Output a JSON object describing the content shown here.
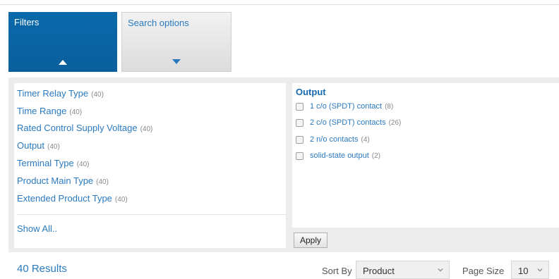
{
  "tabs": {
    "filters_label": "Filters",
    "search_options_label": "Search options"
  },
  "categories": [
    {
      "label": "Timer Relay Type",
      "count": "(40)"
    },
    {
      "label": "Time Range",
      "count": "(40)"
    },
    {
      "label": "Rated Control Supply Voltage",
      "count": "(40)"
    },
    {
      "label": "Output",
      "count": "(40)"
    },
    {
      "label": "Terminal Type",
      "count": "(40)"
    },
    {
      "label": "Product Main Type",
      "count": "(40)"
    },
    {
      "label": "Extended Product Type",
      "count": "(40)"
    }
  ],
  "show_all_label": "Show All..",
  "output_panel": {
    "title": "Output",
    "options": [
      {
        "label": "1 c/o (SPDT) contact",
        "count": "(8)"
      },
      {
        "label": "2 c/o (SPDT) contacts",
        "count": "(26)"
      },
      {
        "label": "2 n/o contacts",
        "count": "(4)"
      },
      {
        "label": "solid-state output",
        "count": "(2)"
      }
    ]
  },
  "apply_label": "Apply",
  "results_label": "40 Results",
  "sort": {
    "label": "Sort By",
    "value": "Product"
  },
  "page_size": {
    "label": "Page Size",
    "value": "10"
  },
  "colors": {
    "accent": "#0b64a4",
    "link": "#2a79bf",
    "panel_bg": "#ececec"
  }
}
